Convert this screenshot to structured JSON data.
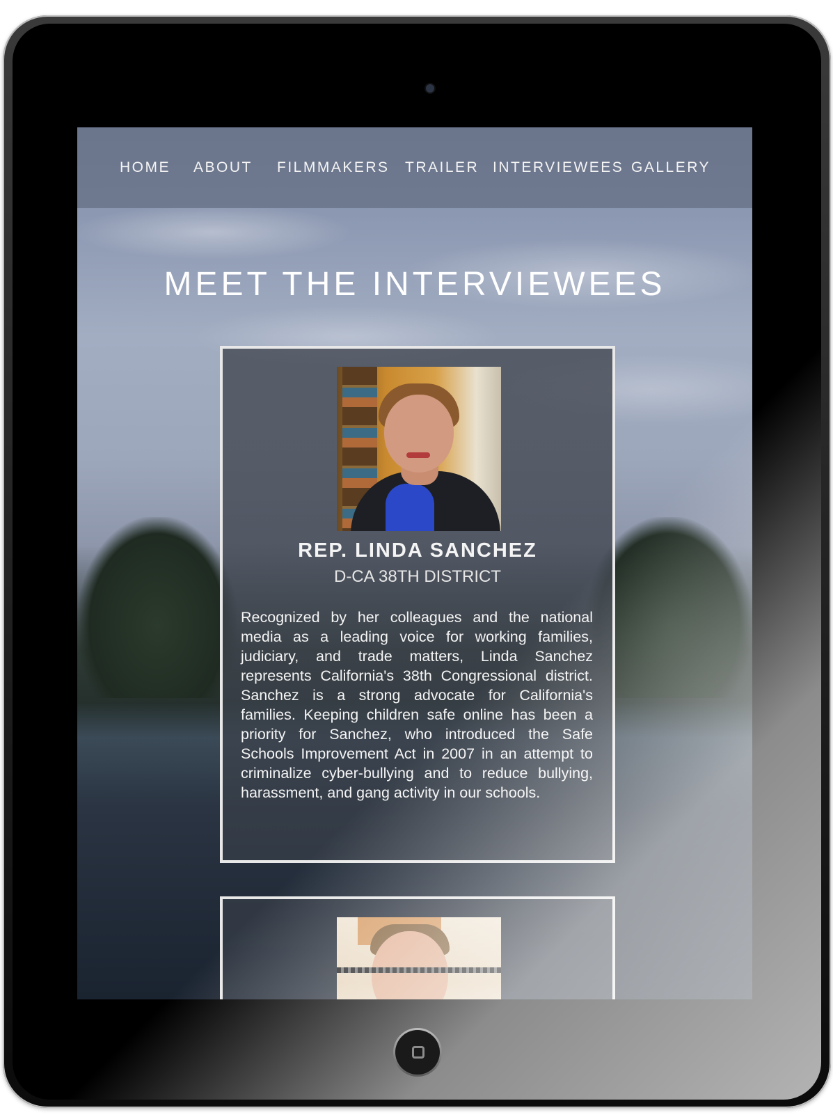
{
  "nav": {
    "items": [
      "HOME",
      "ABOUT",
      "FILMMAKERS",
      "TRAILER",
      "INTERVIEWEES",
      "GALLERY"
    ]
  },
  "page": {
    "title": "MEET THE INTERVIEWEES"
  },
  "interviewees": [
    {
      "name": "REP. LINDA SANCHEZ",
      "district": "D-CA 38TH DISTRICT",
      "bio": "Recognized by her colleagues and the national media as a leading voice for working families, judiciary, and trade matters, Linda Sanchez represents California's 38th Congressional district. Sanchez is a strong advocate for California's families. Keeping children safe online has been a priority for Sanchez, who introduced the Safe Schools Improvement Act in 2007 in an attempt to criminalize cyber-bullying and to reduce bullying, harassment, and gang activity in our schools."
    }
  ]
}
